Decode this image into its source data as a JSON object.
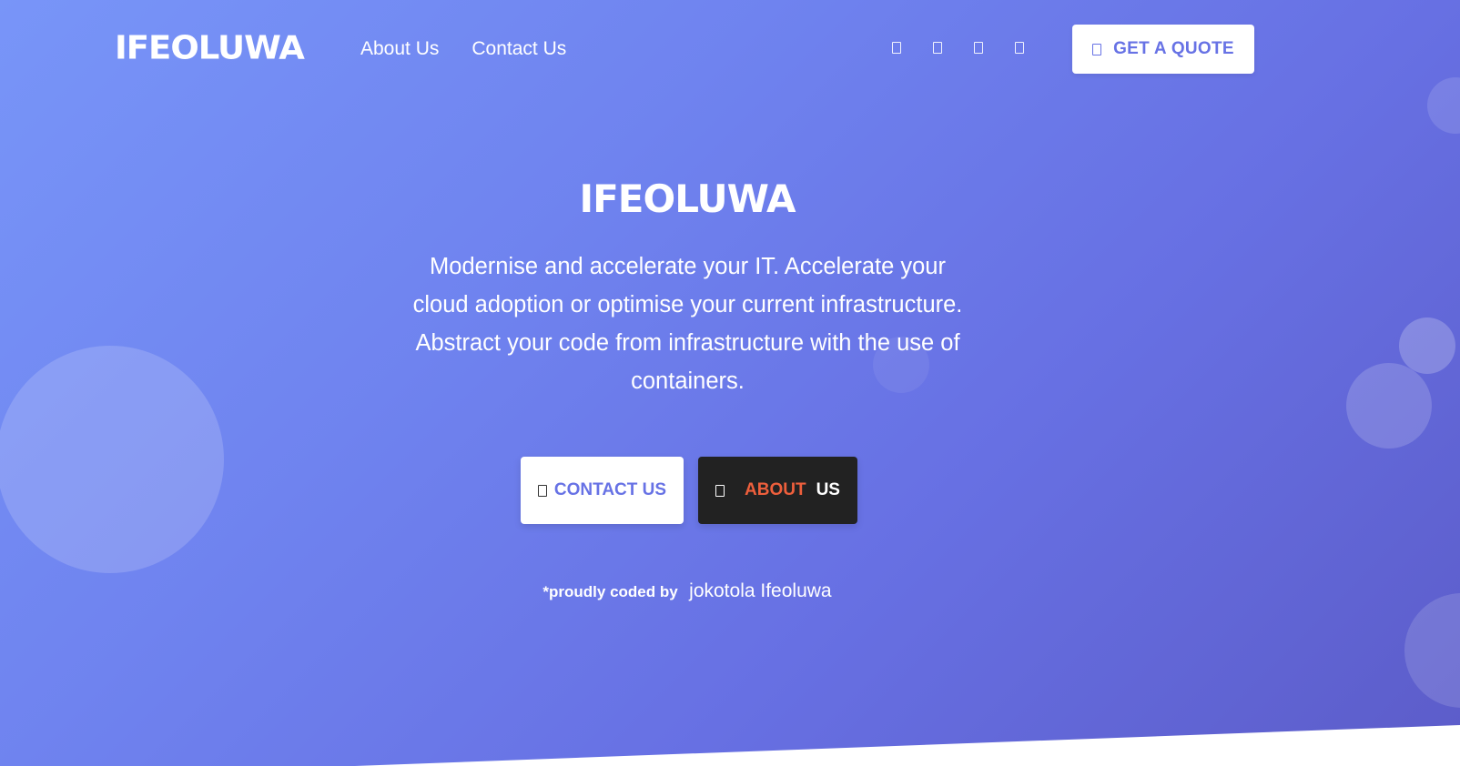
{
  "header": {
    "logo_text": "IFEOLUWA",
    "nav": [
      {
        "label": "About Us"
      },
      {
        "label": "Contact Us"
      }
    ],
    "social_icons": [
      "twitter-icon",
      "facebook-icon",
      "linkedin-icon",
      "github-icon"
    ],
    "quote_button": {
      "icon": "envelope-icon",
      "label": "GET A QUOTE"
    }
  },
  "hero": {
    "title": "IFEOLUWA",
    "description": "Modernise and accelerate your IT. Accelerate your cloud adoption or optimise your current infrastructure. Abstract your code from infrastructure with the use of containers.",
    "contact_button": {
      "icon": "phone-icon",
      "label": "CONTACT US"
    },
    "about_button": {
      "icon": "info-icon",
      "label_part1": "ABOUT",
      "label_part2": "US"
    },
    "credit_prefix": "*proudly coded by",
    "credit_author": "jokotola Ifeoluwa"
  },
  "colors": {
    "gradient_start": "#7895f8",
    "gradient_end": "#5c5cc9",
    "accent": "#6772e5",
    "about_highlight": "#ee5f3c",
    "dark_button": "#222222"
  }
}
